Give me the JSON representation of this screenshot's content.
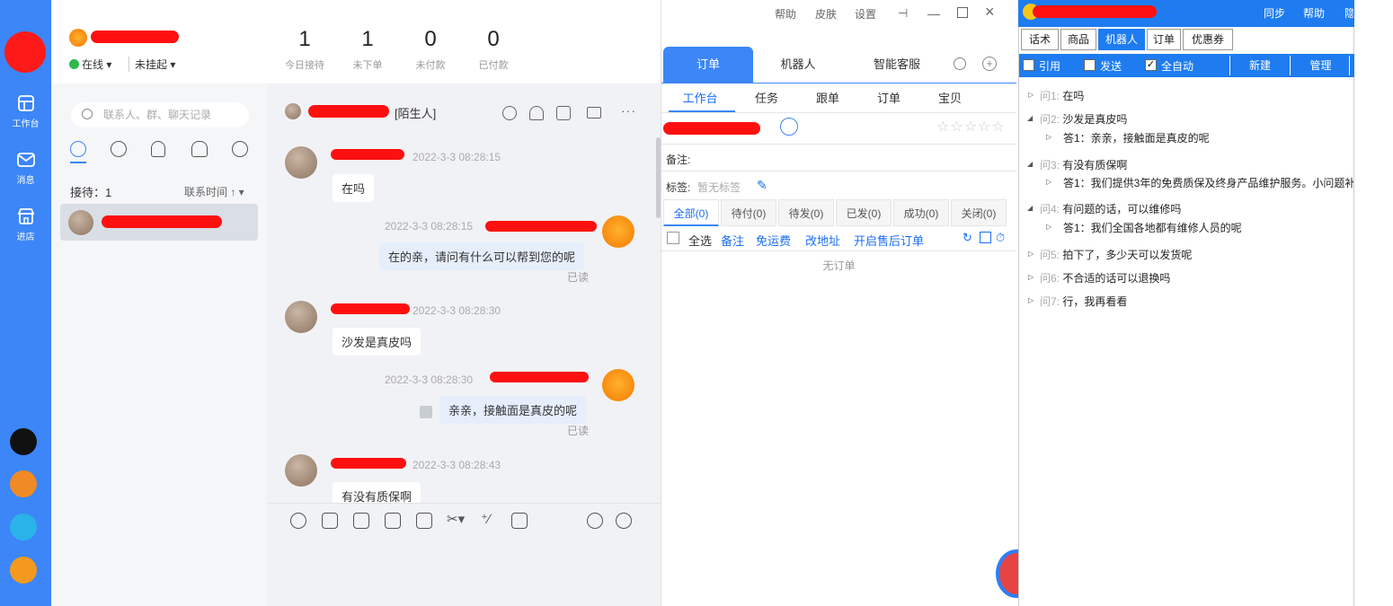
{
  "rail": {
    "items": [
      {
        "label": "工作台"
      },
      {
        "label": "消息"
      },
      {
        "label": "进店"
      }
    ]
  },
  "profile": {
    "status": "在线",
    "hangup": "未挂起"
  },
  "stats": [
    {
      "value": "1",
      "label": "今日接待"
    },
    {
      "value": "1",
      "label": "未下单"
    },
    {
      "value": "0",
      "label": "未付款"
    },
    {
      "value": "0",
      "label": "已付款"
    }
  ],
  "contacts": {
    "search_placeholder": "联系人、群、聊天记录",
    "reception": "接待：1",
    "sort": "联系时间"
  },
  "chat": {
    "stranger_tag": "[陌生人]",
    "messages": [
      {
        "time": "2022-3-3 08:28:15",
        "text": "在吗"
      },
      {
        "time": "2022-3-3 08:28:15",
        "text": "在的亲，请问有什么可以帮到您的呢",
        "status": "已读"
      },
      {
        "time": "2022-3-3 08:28:30",
        "text": "沙发是真皮吗"
      },
      {
        "time": "2022-3-3 08:28:30",
        "text": "亲亲，接触面是真皮的呢",
        "status": "已读"
      },
      {
        "time": "2022-3-3 08:28:43",
        "text": "有没有质保啊"
      }
    ]
  },
  "window_menu": {
    "help": "帮助",
    "skin": "皮肤",
    "settings": "设置"
  },
  "order": {
    "tabs": [
      "订单",
      "机器人",
      "智能客服"
    ],
    "subtabs": [
      "工作台",
      "任务",
      "跟单",
      "订单",
      "宝贝"
    ],
    "note_label": "备注:",
    "tag_label": "标签:",
    "tag_value": "暂无标签",
    "filters": [
      "全部(0)",
      "待付(0)",
      "待发(0)",
      "已发(0)",
      "成功(0)",
      "关闭(0)"
    ],
    "select_all": "全选",
    "actions": [
      "备注",
      "免运费",
      "改地址",
      "开启售后订单"
    ],
    "empty": "无订单"
  },
  "robot": {
    "header_buttons": [
      "同步",
      "帮助",
      "隐"
    ],
    "tabs": [
      "话术",
      "商品",
      "机器人",
      "订单",
      "优惠券"
    ],
    "toolbar": {
      "quote": "引用",
      "send": "发送",
      "auto": "全自动",
      "new": "新建",
      "manage": "管理"
    },
    "qa": [
      {
        "q_prefix": "问1:",
        "q": "在吗"
      },
      {
        "q_prefix": "问2:",
        "q": "沙发是真皮吗",
        "a": "答1：亲亲，接触面是真皮的呢"
      },
      {
        "q_prefix": "问3:",
        "q": "有没有质保啊",
        "a": "答1：我们提供3年的免费质保及终身产品维护服务。小问题补"
      },
      {
        "q_prefix": "问4:",
        "q": "有问题的话，可以维修吗",
        "a": "答1：我们全国各地都有维修人员的呢"
      },
      {
        "q_prefix": "问5:",
        "q": "拍下了，多少天可以发货呢"
      },
      {
        "q_prefix": "问6:",
        "q": "不合适的话可以退换吗"
      },
      {
        "q_prefix": "问7:",
        "q": "行，我再看看"
      }
    ]
  }
}
